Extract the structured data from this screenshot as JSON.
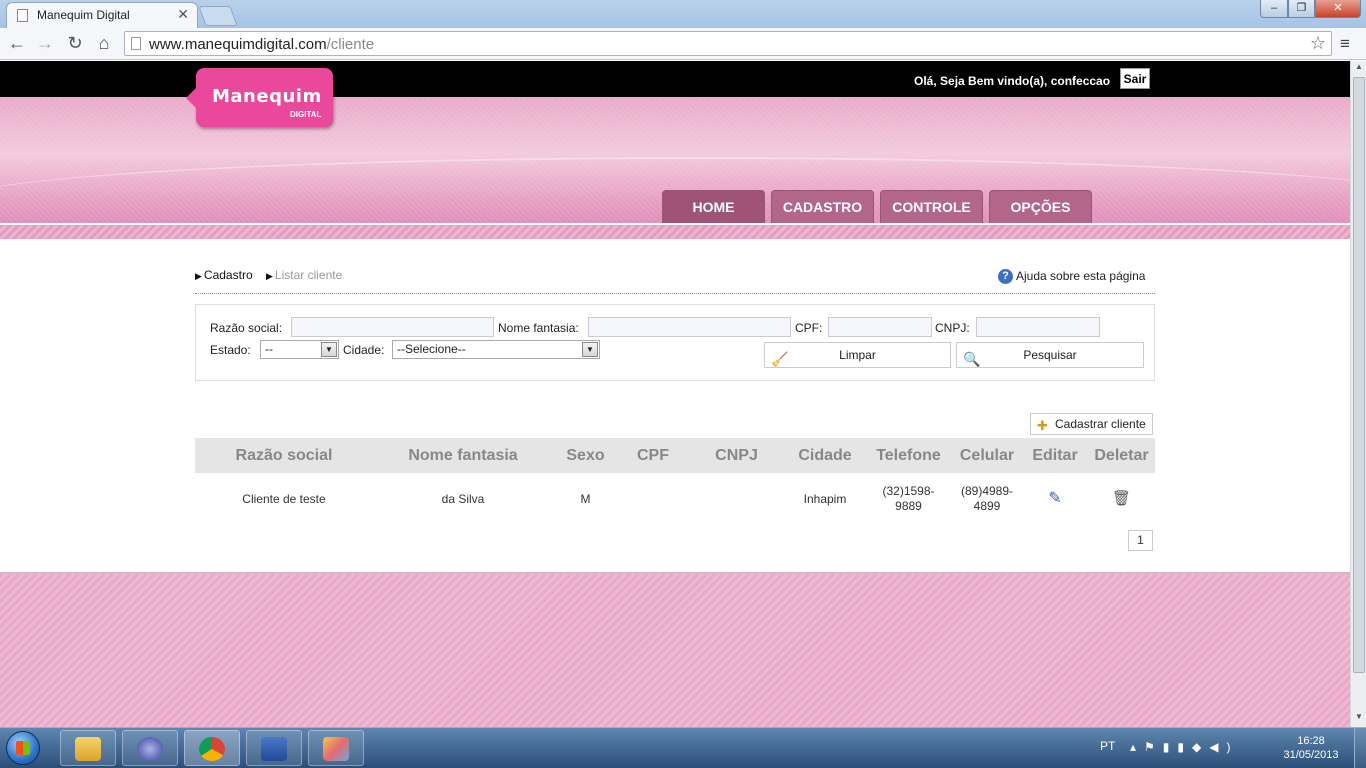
{
  "browser": {
    "tab_title": "Manequim Digital",
    "url_domain": "www.manequimdigital.com",
    "url_path": "/cliente"
  },
  "topbar": {
    "greeting": "Olá, Seja Bem vindo(a), confeccao",
    "logout_label": "Sair"
  },
  "logo": {
    "name": "Manequim",
    "sub": "DIGITAL"
  },
  "nav": {
    "items": [
      {
        "label": "HOME"
      },
      {
        "label": "CADASTRO"
      },
      {
        "label": "CONTROLE"
      },
      {
        "label": "OPÇÕES"
      }
    ]
  },
  "breadcrumb": {
    "parent": "Cadastro",
    "current": "Listar cliente"
  },
  "help": {
    "label": "Ajuda sobre esta página"
  },
  "filters": {
    "razao_label": "Razão social:",
    "fantasia_label": "Nome fantasia:",
    "cpf_label": "CPF:",
    "cnpj_label": "CNPJ:",
    "estado_label": "Estado:",
    "estado_value": "--",
    "cidade_label": "Cidade:",
    "cidade_value": "--Selecione--",
    "clear_label": "Limpar",
    "search_label": "Pesquisar"
  },
  "add_button": {
    "label": "Cadastrar cliente"
  },
  "table": {
    "headers": [
      "Razão social",
      "Nome fantasia",
      "Sexo",
      "CPF",
      "CNPJ",
      "Cidade",
      "Telefone",
      "Celular",
      "Editar",
      "Deletar"
    ],
    "rows": [
      {
        "razao": "Cliente de teste",
        "fantasia": "da Silva",
        "sexo": "M",
        "cpf": "",
        "cnpj": "",
        "cidade": "Inhapim",
        "telefone_1": "(32)1598-",
        "telefone_2": "9889",
        "celular_1": "(89)4989-",
        "celular_2": "4899"
      }
    ]
  },
  "pager": {
    "current": "1"
  },
  "taskbar": {
    "lang": "PT",
    "time": "16:28",
    "date": "31/05/2013"
  }
}
